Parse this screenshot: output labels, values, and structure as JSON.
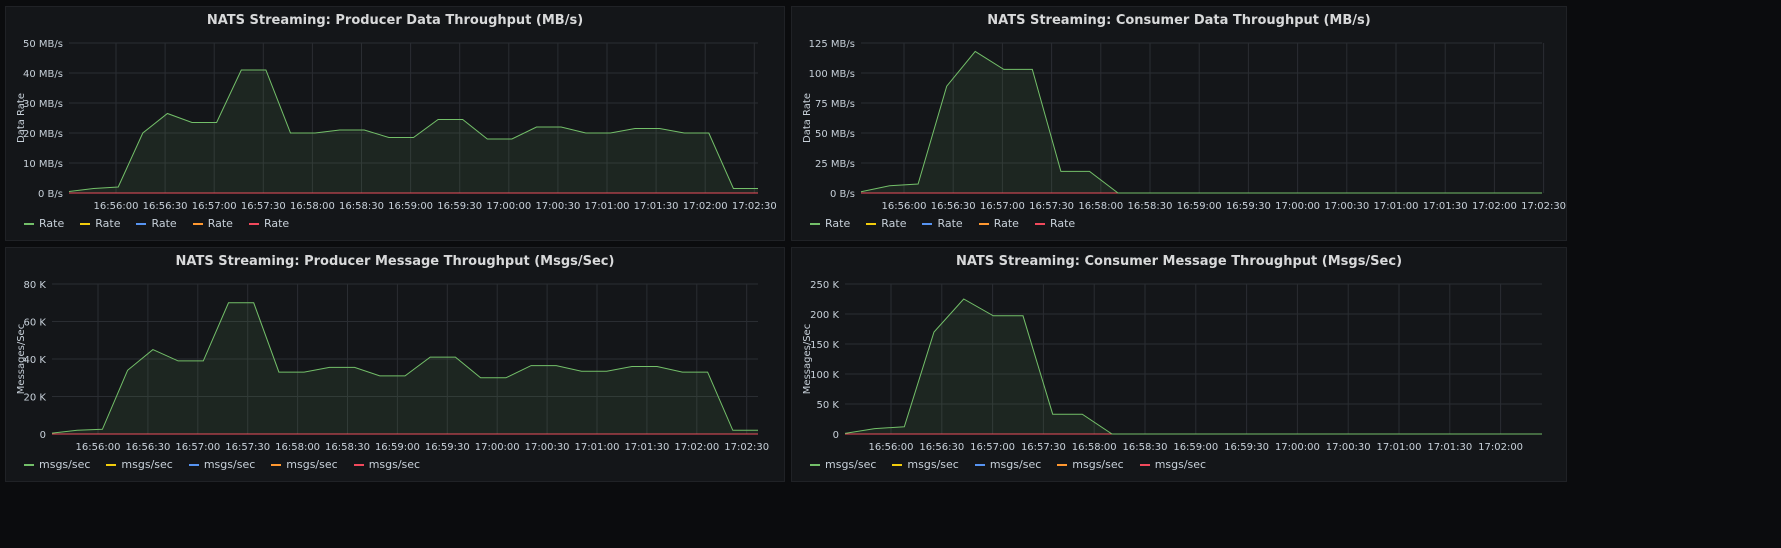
{
  "time_ticks": [
    "16:56:00",
    "16:56:30",
    "16:57:00",
    "16:57:30",
    "16:58:00",
    "16:58:30",
    "16:59:00",
    "16:59:30",
    "17:00:00",
    "17:00:30",
    "17:01:00",
    "17:01:30",
    "17:02:00",
    "17:02:30"
  ],
  "series_colors": [
    "#73bf69",
    "#f2cc0c",
    "#5794f2",
    "#ff9830",
    "#f2495c"
  ],
  "panels": [
    {
      "title": "NATS Streaming: Producer Data Throughput (MB/s)",
      "legend": [
        "Rate",
        "Rate",
        "Rate",
        "Rate",
        "Rate"
      ],
      "chart_data": {
        "type": "area",
        "x": [
          "16:55:40",
          "16:55:50",
          "16:56:00",
          "16:56:10",
          "16:56:20",
          "16:56:30",
          "16:56:40",
          "16:56:50",
          "16:57:00",
          "16:57:10",
          "16:57:20",
          "16:57:30",
          "16:57:40",
          "16:57:50",
          "16:58:00",
          "16:58:10",
          "16:58:20",
          "16:58:30",
          "16:58:40",
          "16:58:50",
          "16:59:00",
          "16:59:10",
          "16:59:20",
          "16:59:30",
          "16:59:40",
          "16:59:50",
          "17:00:00",
          "17:00:10",
          "17:00:20",
          "17:00:30",
          "17:00:40",
          "17:00:50",
          "17:01:00",
          "17:01:10",
          "17:01:20",
          "17:01:30",
          "17:01:40",
          "17:01:50",
          "17:02:00",
          "17:02:10",
          "17:02:20",
          "17:02:30"
        ],
        "series": [
          {
            "values": [
              0.5,
              1.5,
              2,
              20,
              26.5,
              23.5,
              23.5,
              41,
              41,
              20,
              20,
              21,
              21,
              18.5,
              18.5,
              24.5,
              24.5,
              18,
              18,
              22,
              22,
              20,
              20,
              21.5,
              21.5,
              20,
              20,
              1.5,
              1.5
            ]
          }
        ],
        "y_ticks": [
          "0 B/s",
          "10 MB/s",
          "20 MB/s",
          "30 MB/s",
          "40 MB/s",
          "50 MB/s"
        ],
        "ylim": [
          0,
          50
        ],
        "ylabel": "Data Rate"
      }
    },
    {
      "title": "NATS Streaming: Consumer Data Throughput (MB/s)",
      "legend": [
        "Rate",
        "Rate",
        "Rate",
        "Rate",
        "Rate"
      ],
      "chart_data": {
        "type": "area",
        "series": [
          {
            "values": [
              1,
              6,
              7.5,
              89,
              118,
              103,
              103,
              18,
              18,
              0
            ]
          }
        ],
        "y_ticks": [
          "0 B/s",
          "25 MB/s",
          "50 MB/s",
          "75 MB/s",
          "100 MB/s",
          "125 MB/s"
        ],
        "ylim": [
          0,
          125
        ],
        "ylabel": "Data Rate"
      }
    },
    {
      "title": "NATS Streaming: Producer Message Throughput (Msgs/Sec)",
      "legend": [
        "msgs/sec",
        "msgs/sec",
        "msgs/sec",
        "msgs/sec",
        "msgs/sec"
      ],
      "chart_data": {
        "type": "area",
        "series": [
          {
            "values": [
              0.5,
              2,
              2.5,
              34,
              45,
              39,
              39,
              70,
              70,
              33,
              33,
              35.5,
              35.5,
              31,
              31,
              41,
              41,
              30,
              30,
              36.5,
              36.5,
              33.5,
              33.5,
              36,
              36,
              33,
              33,
              2,
              2
            ]
          }
        ],
        "y_ticks": [
          "0",
          "20 K",
          "40 K",
          "60 K",
          "80 K"
        ],
        "ylim": [
          0,
          80
        ],
        "ylabel": "Messages/Sec"
      }
    },
    {
      "title": "NATS Streaming: Consumer Message Throughput (Msgs/Sec)",
      "legend": [
        "msgs/sec",
        "msgs/sec",
        "msgs/sec",
        "msgs/sec",
        "msgs/sec"
      ],
      "chart_data": {
        "type": "area",
        "series": [
          {
            "values": [
              1,
              9,
              12,
              170,
              225,
              197,
              197,
              33,
              33,
              0
            ]
          }
        ],
        "y_ticks": [
          "0",
          "50 K",
          "100 K",
          "150 K",
          "200 K",
          "250 K"
        ],
        "ylim": [
          0,
          250
        ],
        "ylabel": "Messages/Sec"
      }
    }
  ]
}
